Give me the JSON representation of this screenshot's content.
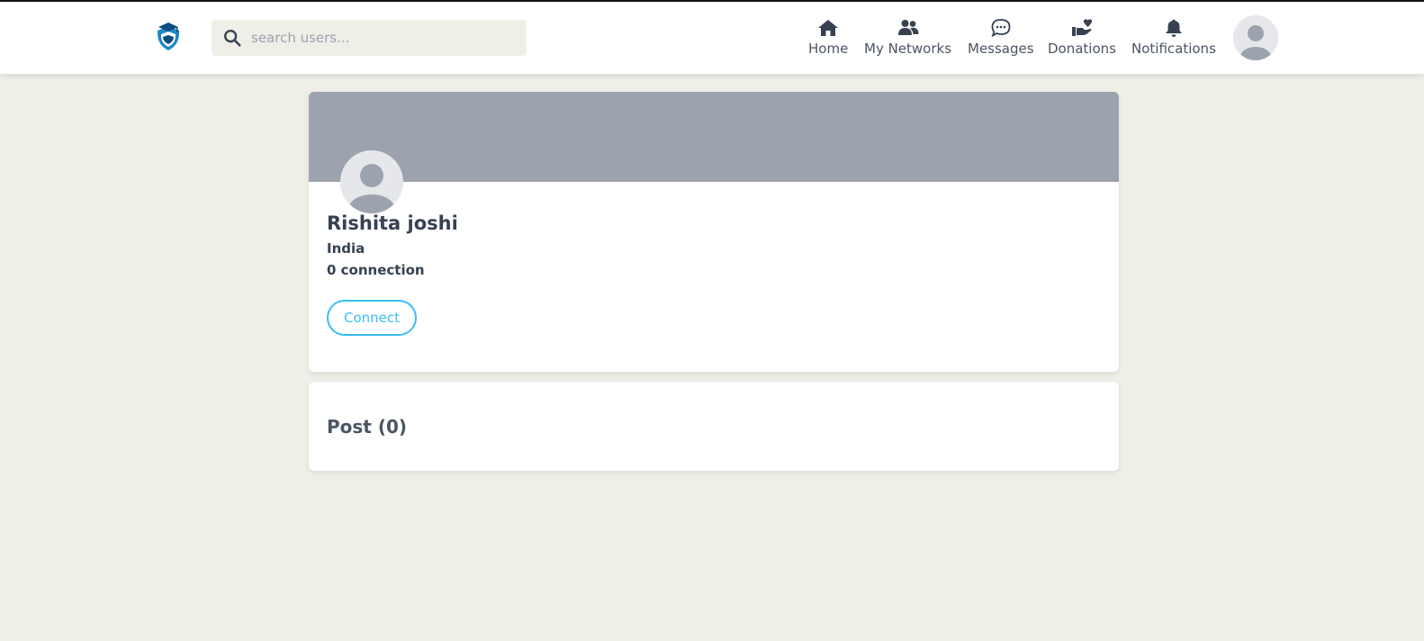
{
  "search": {
    "placeholder": "search users..."
  },
  "nav": {
    "home": "Home",
    "networks": "My Networks",
    "messages": "Messages",
    "donations": "Donations",
    "notifications": "Notifications"
  },
  "profile": {
    "name": "Rishita joshi",
    "country": "India",
    "connections": "0 connection",
    "connect_label": "Connect"
  },
  "posts": {
    "title": "Post (0)"
  },
  "colors": {
    "background": "#efeee7",
    "cover": "#9ca3af",
    "accent": "#38bdf8",
    "icon": "#374151",
    "logo_blue": "#1e88c8"
  },
  "icons": {
    "logo": "graduation-shield-logo",
    "search": "search-icon",
    "home": "home-icon",
    "networks": "users-icon",
    "messages": "chat-bubble-icon",
    "donations": "hand-heart-icon",
    "notifications": "bell-icon",
    "avatar": "user-avatar-icon"
  }
}
